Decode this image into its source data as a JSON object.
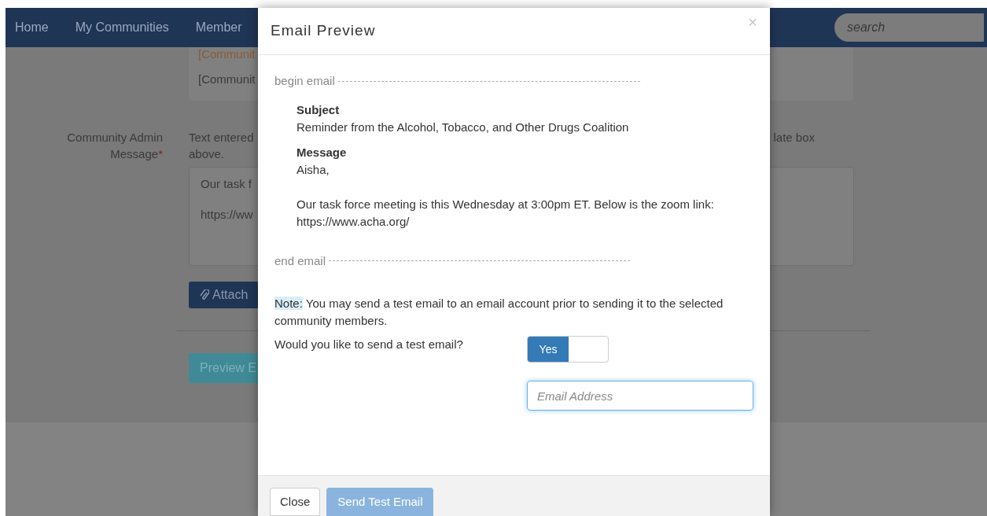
{
  "nav": {
    "items": [
      "Home",
      "My Communities",
      "Member"
    ],
    "search": {
      "placeholder": "search"
    }
  },
  "background_form": {
    "template_lines": [
      "[Communit",
      "[Communit"
    ],
    "admin_message": {
      "label": "Community Admin Message",
      "required_mark": "*",
      "help_left": "Text entered",
      "help_right": "late box",
      "help_line2": "above.",
      "lines": [
        "Our task f",
        "https://ww"
      ]
    },
    "attach_button": "Attach",
    "preview_button": "Preview E"
  },
  "modal": {
    "title": "Email Preview",
    "close_symbol": "×",
    "begin_marker": "begin email",
    "end_marker": "end email",
    "subject_label": "Subject",
    "subject": "Reminder from the Alcohol, Tobacco, and Other Drugs Coalition",
    "message_label": "Message",
    "message_lines": [
      "Aisha,",
      "Our task force meeting is this Wednesday at 3:00pm ET. Below is the zoom link:",
      "https://www.acha.org/"
    ],
    "note": {
      "label": "Note:",
      "text": " You may send a test email to an email account prior to sending it to the selected community members."
    },
    "question": "Would you like to send a test email?",
    "toggle": {
      "label": "Yes",
      "on": true
    },
    "email_field": {
      "placeholder": "Email Address"
    },
    "footer": {
      "close_button": "Close",
      "send_button": {
        "label": "Send Test Email",
        "disabled": true
      }
    }
  }
}
